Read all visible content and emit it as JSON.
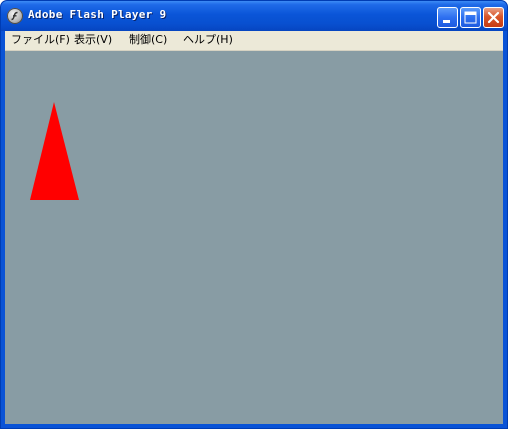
{
  "window": {
    "title": "Adobe Flash Player 9",
    "app_icon": "flash-player-icon",
    "controls": [
      "minimize-icon",
      "maximize-icon",
      "close-icon"
    ]
  },
  "menu": {
    "items": [
      {
        "label": "ファイル(F)"
      },
      {
        "label": "表示(V)"
      },
      {
        "label": "制御(C)"
      },
      {
        "label": "ヘルプ(H)"
      }
    ]
  },
  "stage": {
    "background": "#889ca4",
    "shapes": [
      {
        "type": "triangle",
        "fill": "#ff0000"
      }
    ]
  },
  "colors": {
    "titlebar": "#0a55d8",
    "menubar": "#ece9d8",
    "close_button": "#d9562b"
  }
}
